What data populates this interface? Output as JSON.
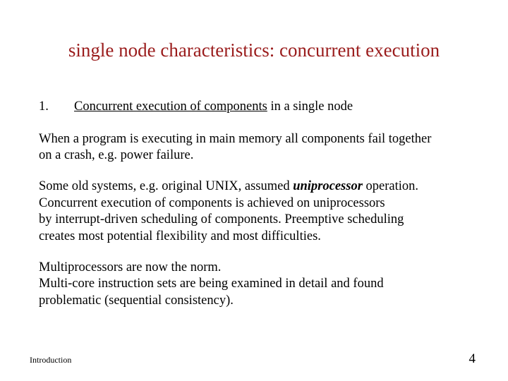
{
  "title": "single node characteristics: concurrent execution",
  "item": {
    "num": "1.",
    "heading_underlined": "Concurrent execution of components",
    "heading_rest": " in a single node"
  },
  "para1": {
    "l1": "When a program is executing in main memory all components fail together",
    "l2": "on a crash, e.g. power failure."
  },
  "para2": {
    "prefix": "Some old systems, e.g. original UNIX, assumed ",
    "em": "uniprocessor",
    "suffix": " operation.",
    "l2": "Concurrent execution of components is achieved on uniprocessors",
    "l3": "by interrupt-driven scheduling of components. Preemptive scheduling",
    "l4": "creates most potential flexibility and most difficulties."
  },
  "para3": {
    "l1": "Multiprocessors are now the norm.",
    "l2": "Multi-core instruction sets are being examined in detail and found",
    "l3": "problematic (sequential consistency)."
  },
  "footer": {
    "left": "Introduction",
    "page": "4"
  }
}
